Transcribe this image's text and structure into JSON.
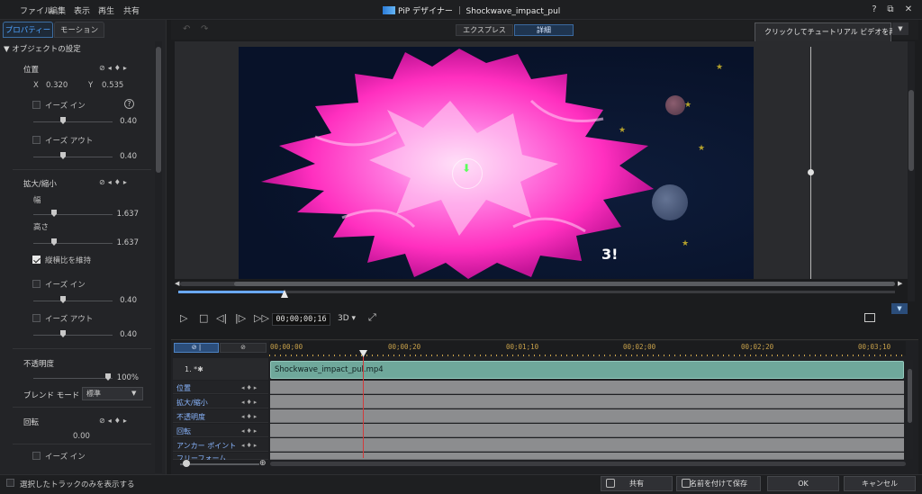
{
  "menu": [
    "ファイル",
    "編集",
    "表示",
    "再生",
    "共有"
  ],
  "title": "PiP デザイナー ｜ Shockwave_impact_pul",
  "window_controls": {
    "help": "?",
    "restore": "⧉",
    "close": "✕"
  },
  "left_panel": {
    "tabs": [
      "プロパティー",
      "モーション"
    ],
    "section_title": "オブジェクトの設定",
    "position": {
      "label": "位置",
      "x_label": "X",
      "x_value": "0.320",
      "y_label": "Y",
      "y_value": "0.535",
      "ease_in": "イーズ イン",
      "ease_in_value": "0.40",
      "ease_out": "イーズ アウト",
      "ease_out_value": "0.40"
    },
    "scale": {
      "label": "拡大/縮小",
      "width_label": "幅",
      "width_value": "1.637",
      "height_label": "高さ",
      "height_value": "1.637",
      "keep_aspect": "縦横比を維持",
      "ease_in": "イーズ イン",
      "ease_in_value": "0.40",
      "ease_out": "イーズ アウト",
      "ease_out_value": "0.40"
    },
    "opacity": {
      "label": "不透明度",
      "value": "100%"
    },
    "blend": {
      "label": "ブレンド モード",
      "value": "標準"
    },
    "rotation": {
      "label": "回転",
      "value": "0.00",
      "ease_in": "イーズ イン"
    }
  },
  "view_modes": [
    "エクスプレス",
    "詳細"
  ],
  "tooltip": "クリックしてチュートリアル ビデオを再生",
  "preview": {
    "overlay_text": "3!"
  },
  "player": {
    "timecode": "00;00;00;16",
    "mode_3d": "3D ▾"
  },
  "timeline": {
    "ruler": [
      "00;00;00",
      "00;00;20",
      "00;01;10",
      "00;02;00",
      "00;02;20",
      "00;03;10"
    ],
    "track_label": "1. *✱",
    "clip_name": "Shockwave_impact_pul.mp4",
    "keyframe_rows": [
      "位置",
      "拡大/縮小",
      "不透明度",
      "回転",
      "アンカー ポイント",
      "フリーフォーム"
    ]
  },
  "bottom": {
    "only_selected": "選択したトラックのみを表示する",
    "share": "共有",
    "save_as": "名前を付けて保存",
    "ok": "OK",
    "cancel": "キャンセル"
  },
  "colors": {
    "accent": "#4fa3ff",
    "clip": "#6fa89b",
    "playhead": "#d23b3b",
    "ruler": "#c8a14a",
    "explosion": "#ff3ec8"
  }
}
